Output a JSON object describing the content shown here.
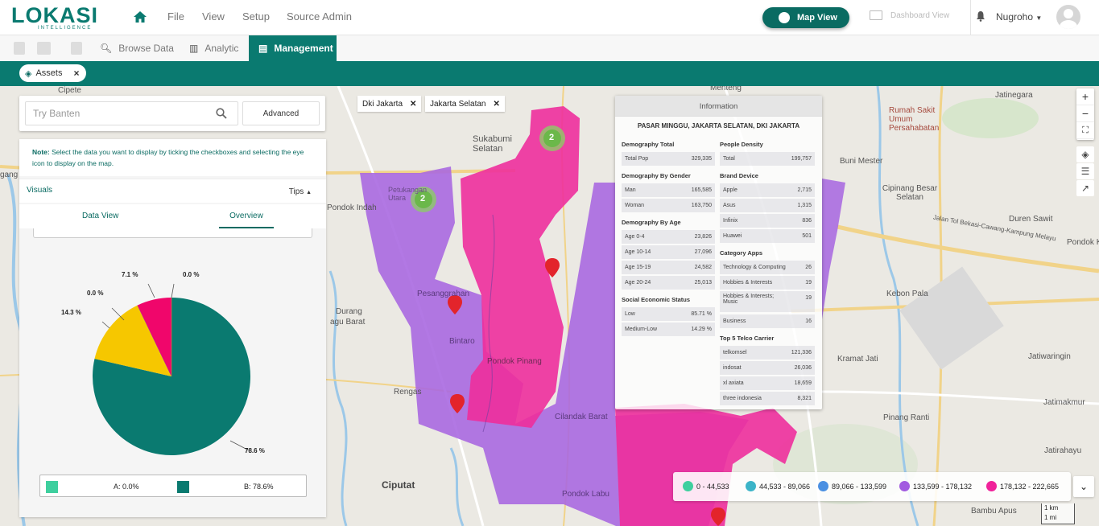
{
  "app": {
    "logo_text": "LOKASI",
    "logo_sub": "INTELLIGENCE"
  },
  "topmenu": [
    "File",
    "View",
    "Setup",
    "Source Admin"
  ],
  "topright": {
    "map_view": "Map View",
    "dashboard_view": "Dashboard View",
    "user": "Nugroho"
  },
  "tabs": [
    {
      "label": "Browse Data",
      "icon": "search-icon"
    },
    {
      "label": "Analytic",
      "icon": "bar-chart-icon"
    },
    {
      "label": "Management",
      "icon": "clipboard-icon",
      "active": true
    }
  ],
  "assets_chip": {
    "label": "Assets",
    "close": "×"
  },
  "search": {
    "placeholder": "Try Banten",
    "advanced": "Advanced"
  },
  "panel": {
    "note_bold": "Note:",
    "note_text": "Select the data you want to display by ticking the checkboxes and selecting the eye icon to display on the map.",
    "visuals": "Visuals",
    "tips": "Tips",
    "subtabs": [
      "Data View",
      "Overview"
    ],
    "active_subtab": "Overview",
    "legend": [
      {
        "label": "A: 0.0%",
        "color": "#3ecf9e"
      },
      {
        "label": "B: 78.6%",
        "color": "#0a7a70"
      }
    ]
  },
  "chart_data": {
    "type": "pie",
    "slices": [
      {
        "label": "78.6 %",
        "value": 78.6,
        "color": "#0a7a70"
      },
      {
        "label": "14.3 %",
        "value": 14.3,
        "color": "#f6c700"
      },
      {
        "label": "0.0 %",
        "value": 0.0,
        "color": "#6a4fd0"
      },
      {
        "label": "7.1 %",
        "value": 7.1,
        "color": "#f0066b"
      },
      {
        "label": "0.0 %",
        "value": 0.0,
        "color": "#f08a2a"
      }
    ]
  },
  "filter_chips": [
    "Dki Jakarta",
    "Jakarta Selatan"
  ],
  "info": {
    "header": "Information",
    "place": "PASAR MINGGU, JAKARTA SELATAN, DKI JAKARTA",
    "left": [
      {
        "title": "Demography Total",
        "rows": [
          [
            "Total Pop",
            "329,335"
          ]
        ]
      },
      {
        "title": "Demography By Gender",
        "rows": [
          [
            "Man",
            "165,585"
          ],
          [
            "Woman",
            "163,750"
          ]
        ]
      },
      {
        "title": "Demography By Age",
        "rows": [
          [
            "Age 0-4",
            "23,826"
          ],
          [
            "Age 10-14",
            "27,096"
          ],
          [
            "Age 15-19",
            "24,582"
          ],
          [
            "Age 20-24",
            "25,013"
          ]
        ]
      },
      {
        "title": "Social Economic Status",
        "rows": [
          [
            "Low",
            "85.71 %"
          ],
          [
            "Medium-Low",
            "14.29 %"
          ]
        ]
      }
    ],
    "right": [
      {
        "title": "People Density",
        "rows": [
          [
            "Total",
            "199,757"
          ]
        ]
      },
      {
        "title": "Brand Device",
        "rows": [
          [
            "Apple",
            "2,715"
          ],
          [
            "Asus",
            "1,315"
          ],
          [
            "Infinix",
            "836"
          ],
          [
            "Huawei",
            "501"
          ]
        ]
      },
      {
        "title": "Category Apps",
        "rows": [
          [
            "Technology & Computing",
            "26"
          ],
          [
            "Hobbies & Interests",
            "19"
          ],
          [
            "Hobbies & Interests; Music",
            "19"
          ],
          [
            "Business",
            "16"
          ]
        ]
      },
      {
        "title": "Top 5 Telco Carrier",
        "rows": [
          [
            "telkomsel",
            "121,336"
          ],
          [
            "indosat",
            "26,036"
          ],
          [
            "xl axiata",
            "18,659"
          ],
          [
            "three indonesia",
            "8,321"
          ]
        ]
      }
    ]
  },
  "range_legend": [
    {
      "label": "0 - 44,533",
      "color": "#3ecf9e"
    },
    {
      "label": "44,533 - 89,066",
      "color": "#3cb4c8"
    },
    {
      "label": "89,066 - 133,599",
      "color": "#4a90e2"
    },
    {
      "label": "133,599 - 178,132",
      "color": "#a25ce0"
    },
    {
      "label": "178,132 - 222,665",
      "color": "#f0229a"
    }
  ],
  "scale": [
    "1 km",
    "1 mi"
  ],
  "map_labels": [
    "Cipete",
    "Menteng",
    "Jatinegara",
    "Rumah Sakit Umum Persahabatan",
    "Sukabumi Selatan",
    "Petukangan Utara",
    "Buni Mester",
    "Cipinang Besar Selatan",
    "Duren Sawit",
    "Pondok Kel",
    "Pesanggrahan",
    "Kebon Pala",
    "Durang",
    "agu Barat",
    "Bintaro",
    "Pondok Pinang",
    "Kramat Jati",
    "Jatiwaringin",
    "Rengas",
    "Cilandak Barat",
    "Jatimakmur",
    "Pinang Ranti",
    "Jatirahayu",
    "Ciputat",
    "Pondok Labu",
    "Bambu Apus",
    "gang",
    "Pondok Indah",
    "Jalan Tol Bekasi-Cawang-Kampung Melayu"
  ],
  "clusters": [
    "2",
    "2"
  ]
}
